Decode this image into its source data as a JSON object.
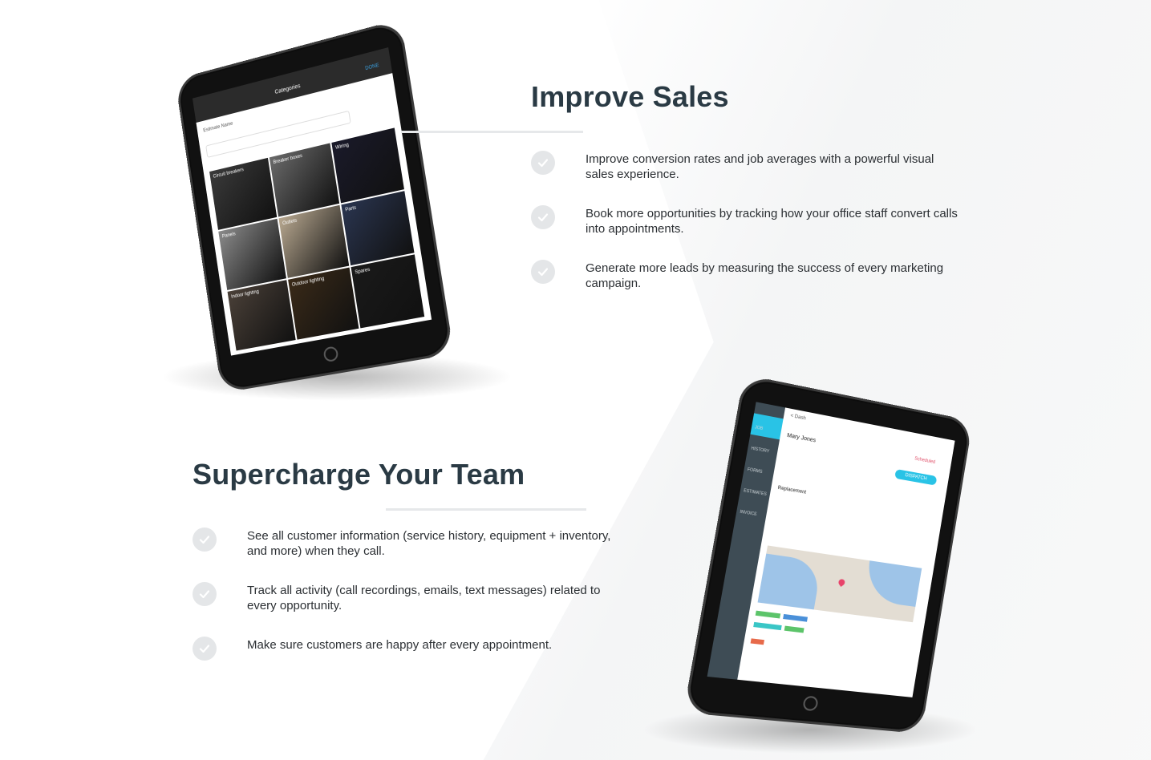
{
  "sales": {
    "title": "Improve Sales",
    "bullets": [
      "Improve conversion rates and job averages with a powerful visual sales experience.",
      "Book more opportunities by tracking how your office staff convert calls into appointments.",
      "Generate more leads by measuring the success of every marketing campaign."
    ]
  },
  "team": {
    "title": "Supercharge Your Team",
    "bullets": [
      "See all customer information (service history, equipment + inventory, and more) when they call.",
      "Track all activity (call recordings, emails, text messages) related to every opportunity.",
      "Make sure customers are happy after every appointment."
    ]
  },
  "tablet1": {
    "header": "Categories",
    "done": "DONE",
    "estimate_label": "Estimate Name",
    "tiles": [
      "Circuit breakers",
      "Breaker boxes",
      "Wiring",
      "Panels",
      "Outlets",
      "Parts",
      "Indoor lighting",
      "Outdoor lighting",
      "Spares"
    ]
  },
  "tablet2": {
    "back": "< Dash",
    "customer": "Mary Jones",
    "status": "Scheduled",
    "dispatch": "DISPATCH",
    "job": "Replacement",
    "sidebar": [
      "JOB",
      "HISTORY",
      "FORMS",
      "ESTIMATES",
      "INVOICE"
    ]
  },
  "colors": {
    "title": "#2a3a44",
    "check_bg": "#e4e6e8",
    "rule": "#e6e8ea",
    "accent_teal": "#29c3e6",
    "sidebar": "#3e4c55"
  }
}
